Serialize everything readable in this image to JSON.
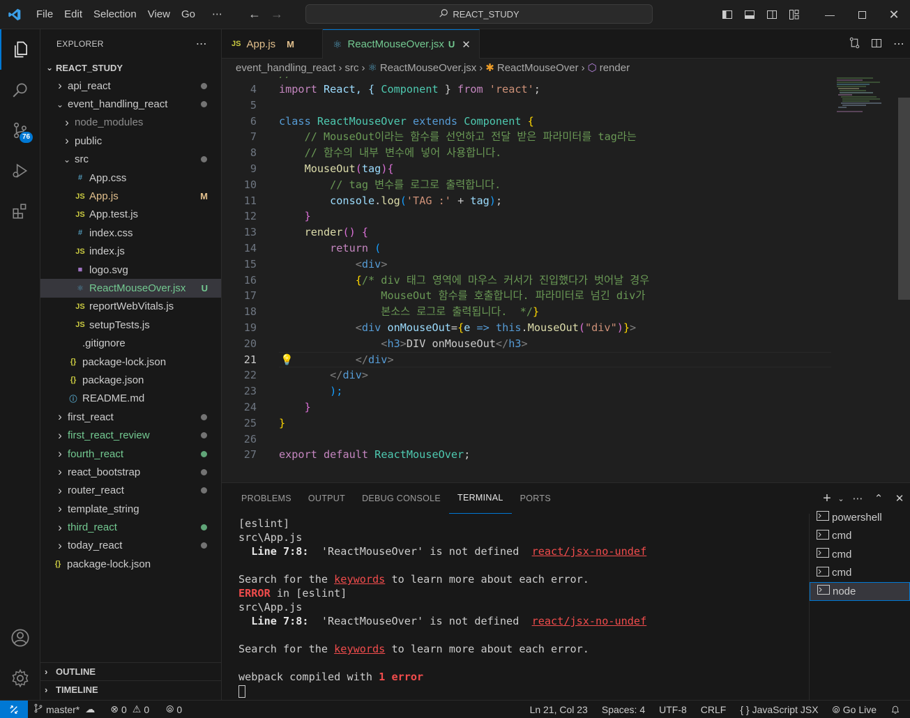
{
  "colors": {
    "accent": "#0078d4",
    "modified": "#e2c08d",
    "untracked": "#73c991",
    "error": "#f14c4c"
  },
  "menu": [
    "File",
    "Edit",
    "Selection",
    "View",
    "Go",
    "⋯"
  ],
  "command_center": "REACT_STUDY",
  "activity": {
    "scm_badge": "76"
  },
  "explorer": {
    "title": "EXPLORER",
    "more": "⋯",
    "project": "REACT_STUDY",
    "outline": "OUTLINE",
    "timeline": "TIMELINE",
    "items": [
      {
        "label": "api_react",
        "depth": 1,
        "kind": "folder",
        "open": false,
        "dot": "#8b8b8b",
        "color": "#cccccc"
      },
      {
        "label": "event_handling_react",
        "depth": 1,
        "kind": "folder",
        "open": true,
        "dot": "#8b8b8b",
        "color": "#cccccc"
      },
      {
        "label": "node_modules",
        "depth": 2,
        "kind": "folder",
        "open": false,
        "dot": "",
        "color": "#8c8c8c"
      },
      {
        "label": "public",
        "depth": 2,
        "kind": "folder",
        "open": false,
        "dot": "",
        "color": "#cccccc"
      },
      {
        "label": "src",
        "depth": 2,
        "kind": "folder",
        "open": true,
        "dot": "#8b8b8b",
        "color": "#cccccc"
      },
      {
        "label": "App.css",
        "depth": 3,
        "kind": "css",
        "git": "",
        "color": "#cccccc"
      },
      {
        "label": "App.js",
        "depth": 3,
        "kind": "js",
        "git": "M",
        "color": "#e2c08d"
      },
      {
        "label": "App.test.js",
        "depth": 3,
        "kind": "js",
        "git": "",
        "color": "#cccccc"
      },
      {
        "label": "index.css",
        "depth": 3,
        "kind": "css",
        "git": "",
        "color": "#cccccc"
      },
      {
        "label": "index.js",
        "depth": 3,
        "kind": "js",
        "git": "",
        "color": "#cccccc"
      },
      {
        "label": "logo.svg",
        "depth": 3,
        "kind": "svg",
        "git": "",
        "color": "#cccccc"
      },
      {
        "label": "ReactMouseOver.jsx",
        "depth": 3,
        "kind": "jsx",
        "git": "U",
        "color": "#73c991",
        "selected": true
      },
      {
        "label": "reportWebVitals.js",
        "depth": 3,
        "kind": "js",
        "git": "",
        "color": "#cccccc"
      },
      {
        "label": "setupTests.js",
        "depth": 3,
        "kind": "js",
        "git": "",
        "color": "#cccccc"
      },
      {
        "label": ".gitignore",
        "depth": 2,
        "kind": "git",
        "git": "",
        "color": "#cccccc"
      },
      {
        "label": "package-lock.json",
        "depth": 2,
        "kind": "json",
        "git": "",
        "color": "#cccccc"
      },
      {
        "label": "package.json",
        "depth": 2,
        "kind": "json",
        "git": "",
        "color": "#cccccc"
      },
      {
        "label": "README.md",
        "depth": 2,
        "kind": "md",
        "git": "",
        "color": "#cccccc"
      },
      {
        "label": "first_react",
        "depth": 1,
        "kind": "folder",
        "open": false,
        "dot": "#8b8b8b",
        "color": "#cccccc"
      },
      {
        "label": "first_react_review",
        "depth": 1,
        "kind": "folder",
        "open": false,
        "dot": "#8b8b8b",
        "color": "#73c991"
      },
      {
        "label": "fourth_react",
        "depth": 1,
        "kind": "folder",
        "open": false,
        "dot": "#73c991",
        "color": "#73c991"
      },
      {
        "label": "react_bootstrap",
        "depth": 1,
        "kind": "folder",
        "open": false,
        "dot": "#8b8b8b",
        "color": "#cccccc"
      },
      {
        "label": "router_react",
        "depth": 1,
        "kind": "folder",
        "open": false,
        "dot": "#8b8b8b",
        "color": "#cccccc"
      },
      {
        "label": "template_string",
        "depth": 1,
        "kind": "folder",
        "open": false,
        "dot": "",
        "color": "#cccccc"
      },
      {
        "label": "third_react",
        "depth": 1,
        "kind": "folder",
        "open": false,
        "dot": "#73c991",
        "color": "#73c991"
      },
      {
        "label": "today_react",
        "depth": 1,
        "kind": "folder",
        "open": false,
        "dot": "#8b8b8b",
        "color": "#cccccc"
      },
      {
        "label": "package-lock.json",
        "depth": 0,
        "kind": "json",
        "git": "",
        "color": "#cccccc"
      }
    ]
  },
  "tabs": [
    {
      "icon": "JS",
      "label": "App.js",
      "status": "M",
      "active": false
    },
    {
      "icon": "⚛",
      "label": "ReactMouseOver.jsx",
      "status": "U",
      "active": true
    }
  ],
  "breadcrumb": [
    "event_handling_react",
    "src",
    "ReactMouseOver.jsx",
    "ReactMouseOver",
    "render"
  ],
  "code": {
    "current_line": 21,
    "lines": [
      {
        "n": "4",
        "t": [
          [
            "import",
            "#c586c0"
          ],
          [
            " React, { ",
            "#9cdcfe"
          ],
          [
            "Component",
            "#4ec9b0"
          ],
          [
            " } ",
            "#cccccc"
          ],
          [
            "from",
            "#c586c0"
          ],
          [
            " 'react'",
            "#ce9178"
          ],
          [
            ";",
            "#cccccc"
          ]
        ]
      },
      {
        "n": "5",
        "t": []
      },
      {
        "n": "6",
        "t": [
          [
            "class",
            "#569cd6"
          ],
          [
            " ReactMouseOver ",
            "#4ec9b0"
          ],
          [
            "extends",
            "#569cd6"
          ],
          [
            " Component ",
            "#4ec9b0"
          ],
          [
            "{",
            "#ffd700"
          ]
        ]
      },
      {
        "n": "7",
        "t": [
          [
            "    // MouseOut이라는 함수를 선언하고 전달 받은 파라미터를 tag라는",
            "#6a9955"
          ]
        ]
      },
      {
        "n": "8",
        "t": [
          [
            "    // 함수의 내부 변수에 넣어 사용합니다.",
            "#6a9955"
          ]
        ]
      },
      {
        "n": "9",
        "t": [
          [
            "    MouseOut",
            "#dcdcaa"
          ],
          [
            "(",
            "#da70d6"
          ],
          [
            "tag",
            "#9cdcfe"
          ],
          [
            ")",
            "#da70d6"
          ],
          [
            "{",
            "#da70d6"
          ]
        ]
      },
      {
        "n": "10",
        "t": [
          [
            "        // tag 변수를 로그로 출력합니다.",
            "#6a9955"
          ]
        ]
      },
      {
        "n": "11",
        "t": [
          [
            "        console",
            "#9cdcfe"
          ],
          [
            ".",
            "#cccccc"
          ],
          [
            "log",
            "#dcdcaa"
          ],
          [
            "(",
            "#179fff"
          ],
          [
            "'TAG :'",
            "#ce9178"
          ],
          [
            " + ",
            "#cccccc"
          ],
          [
            "tag",
            "#9cdcfe"
          ],
          [
            ")",
            "#179fff"
          ],
          [
            ";",
            "#cccccc"
          ]
        ]
      },
      {
        "n": "12",
        "t": [
          [
            "    }",
            "#da70d6"
          ]
        ]
      },
      {
        "n": "13",
        "t": [
          [
            "    render",
            "#dcdcaa"
          ],
          [
            "() ",
            "#da70d6"
          ],
          [
            "{",
            "#da70d6"
          ]
        ]
      },
      {
        "n": "14",
        "t": [
          [
            "        return",
            "#c586c0"
          ],
          [
            " (",
            "#179fff"
          ]
        ]
      },
      {
        "n": "15",
        "t": [
          [
            "            <",
            "#808080"
          ],
          [
            "div",
            "#569cd6"
          ],
          [
            ">",
            "#808080"
          ]
        ]
      },
      {
        "n": "16",
        "t": [
          [
            "            {",
            "#ffd700"
          ],
          [
            "/* div 태그 영역에 마우스 커서가 진입했다가 벗어날 경우",
            "#6a9955"
          ]
        ]
      },
      {
        "n": "17",
        "t": [
          [
            "                MouseOut 함수를 호출합니다. 파라미터로 넘긴 div가",
            "#6a9955"
          ]
        ]
      },
      {
        "n": "18",
        "t": [
          [
            "                본소스 로그로 출력됩니다.  */",
            "#6a9955"
          ],
          [
            "}",
            "#ffd700"
          ]
        ]
      },
      {
        "n": "19",
        "t": [
          [
            "            <",
            "#808080"
          ],
          [
            "div",
            "#569cd6"
          ],
          [
            " onMouseOut",
            "#9cdcfe"
          ],
          [
            "=",
            "#cccccc"
          ],
          [
            "{",
            "#ffd700"
          ],
          [
            "e",
            "#9cdcfe"
          ],
          [
            " => ",
            "#569cd6"
          ],
          [
            "this",
            "#569cd6"
          ],
          [
            ".",
            "#cccccc"
          ],
          [
            "MouseOut",
            "#dcdcaa"
          ],
          [
            "(",
            "#da70d6"
          ],
          [
            "\"div\"",
            "#ce9178"
          ],
          [
            ")",
            "#da70d6"
          ],
          [
            "}",
            "#ffd700"
          ],
          [
            ">",
            "#808080"
          ]
        ]
      },
      {
        "n": "20",
        "t": [
          [
            "                <",
            "#808080"
          ],
          [
            "h3",
            "#569cd6"
          ],
          [
            ">",
            "#808080"
          ],
          [
            "DIV onMouseOut",
            "#cccccc"
          ],
          [
            "</",
            "#808080"
          ],
          [
            "h3",
            "#569cd6"
          ],
          [
            ">",
            "#808080"
          ]
        ]
      },
      {
        "n": "21",
        "t": [
          [
            "            </",
            "#808080"
          ],
          [
            "div",
            "#569cd6"
          ],
          [
            ">",
            "#808080"
          ]
        ]
      },
      {
        "n": "22",
        "t": [
          [
            "        </",
            "#808080"
          ],
          [
            "div",
            "#569cd6"
          ],
          [
            ">",
            "#808080"
          ]
        ]
      },
      {
        "n": "23",
        "t": [
          [
            "        );",
            "#179fff"
          ]
        ]
      },
      {
        "n": "24",
        "t": [
          [
            "    }",
            "#da70d6"
          ]
        ]
      },
      {
        "n": "25",
        "t": [
          [
            "}",
            "#ffd700"
          ]
        ]
      },
      {
        "n": "26",
        "t": []
      },
      {
        "n": "27",
        "t": [
          [
            "export",
            "#c586c0"
          ],
          [
            " default ",
            "#c586c0"
          ],
          [
            "ReactMouseOver",
            "#4ec9b0"
          ],
          [
            ";",
            "#cccccc"
          ]
        ]
      }
    ]
  },
  "panel": {
    "tabs": [
      "PROBLEMS",
      "OUTPUT",
      "DEBUG CONSOLE",
      "TERMINAL",
      "PORTS"
    ],
    "active_tab": "TERMINAL",
    "terminal": [
      [
        [
          "[eslint]",
          "#cccccc"
        ]
      ],
      [
        [
          "src\\App.js",
          "#cccccc"
        ]
      ],
      [
        [
          "  Line 7:8:",
          "#e5e5e5",
          "bold"
        ],
        [
          "  'ReactMouseOver' is not defined  ",
          "#cccccc"
        ],
        [
          "react/jsx-no-undef",
          "#f14c4c",
          "underline"
        ]
      ],
      [],
      [
        [
          "Search for the ",
          "#cccccc"
        ],
        [
          "keywords",
          "#f14c4c",
          "underline"
        ],
        [
          " to learn more about each error.",
          "#cccccc"
        ]
      ],
      [
        [
          "ERROR",
          "#f14c4c",
          "bold"
        ],
        [
          " in [eslint]",
          "#cccccc"
        ]
      ],
      [
        [
          "src\\App.js",
          "#cccccc"
        ]
      ],
      [
        [
          "  Line 7:8:",
          "#e5e5e5",
          "bold"
        ],
        [
          "  'ReactMouseOver' is not defined  ",
          "#cccccc"
        ],
        [
          "react/jsx-no-undef",
          "#f14c4c",
          "underline"
        ]
      ],
      [],
      [
        [
          "Search for the ",
          "#cccccc"
        ],
        [
          "keywords",
          "#f14c4c",
          "underline"
        ],
        [
          " to learn more about each error.",
          "#cccccc"
        ]
      ],
      [],
      [
        [
          "webpack compiled with ",
          "#cccccc"
        ],
        [
          "1 error",
          "#f14c4c",
          "bold"
        ]
      ]
    ],
    "terminals": [
      "powershell",
      "cmd",
      "cmd",
      "cmd",
      "node"
    ],
    "active_terminal": 4
  },
  "status": {
    "branch": "master*",
    "errors": "0",
    "warnings": "0",
    "ports": "0",
    "position": "Ln 21, Col 23",
    "spaces": "Spaces: 4",
    "encoding": "UTF-8",
    "eol": "CRLF",
    "language": "JavaScript JSX",
    "golive": "Go Live"
  }
}
